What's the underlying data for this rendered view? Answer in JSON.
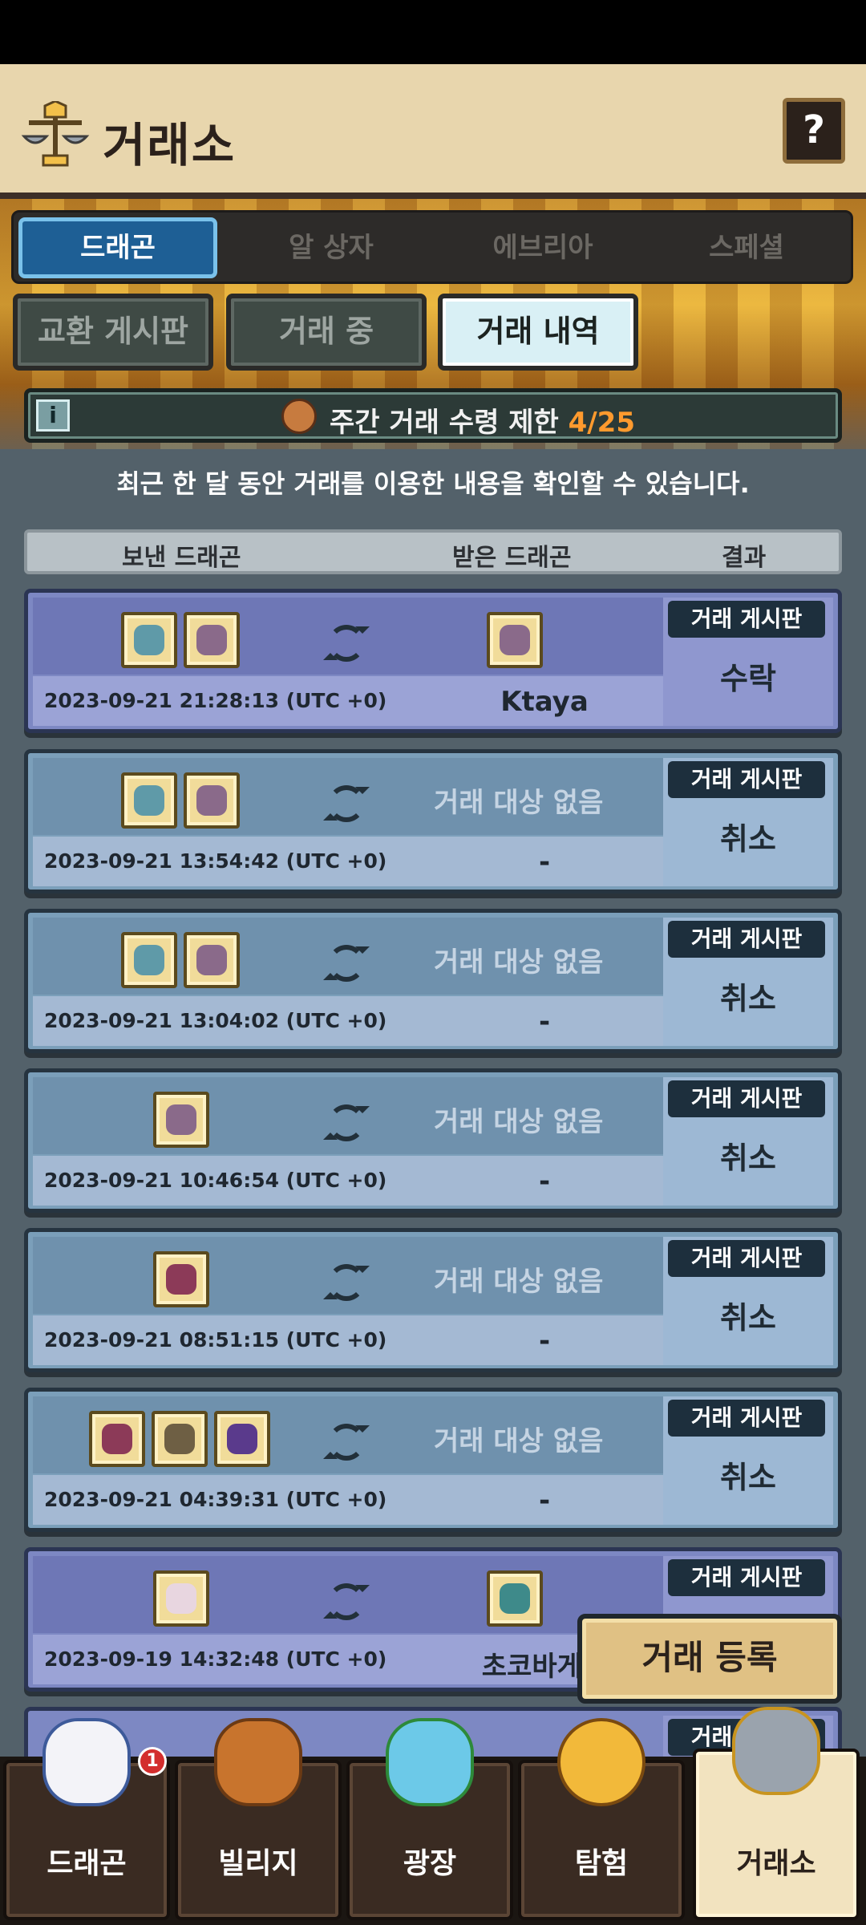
{
  "header": {
    "title": "거래소",
    "help_label": "?"
  },
  "species_tabs": [
    {
      "label": "드래곤",
      "active": true
    },
    {
      "label": "알 상자",
      "active": false
    },
    {
      "label": "에브리아",
      "active": false
    },
    {
      "label": "스페셜",
      "active": false
    }
  ],
  "sub_tabs": [
    {
      "label": "교환 게시판",
      "active": false
    },
    {
      "label": "거래 중",
      "active": false
    },
    {
      "label": "거래 내역",
      "active": true
    }
  ],
  "limit": {
    "label": "주간 거래 수령 제한",
    "count": "4/25"
  },
  "notice": "최근 한 달 동안 거래를 이용한 내용을 확인할 수 있습니다.",
  "table_header": {
    "sent": "보낸 드래곤",
    "received": "받은 드래곤",
    "result": "결과"
  },
  "rows": [
    {
      "date": "2023-09-21 21:28:13 (UTC +0)",
      "partner": "Ktaya",
      "board": "거래 게시판",
      "outcome": "수락",
      "received_text": ""
    },
    {
      "date": "2023-09-21 13:54:42 (UTC +0)",
      "partner": "-",
      "board": "거래 게시판",
      "outcome": "취소",
      "received_text": "거래 대상 없음"
    },
    {
      "date": "2023-09-21 13:04:02 (UTC +0)",
      "partner": "-",
      "board": "거래 게시판",
      "outcome": "취소",
      "received_text": "거래 대상 없음"
    },
    {
      "date": "2023-09-21 10:46:54 (UTC +0)",
      "partner": "-",
      "board": "거래 게시판",
      "outcome": "취소",
      "received_text": "거래 대상 없음"
    },
    {
      "date": "2023-09-21 08:51:15 (UTC +0)",
      "partner": "-",
      "board": "거래 게시판",
      "outcome": "취소",
      "received_text": "거래 대상 없음"
    },
    {
      "date": "2023-09-21 04:39:31 (UTC +0)",
      "partner": "-",
      "board": "거래 게시판",
      "outcome": "취소",
      "received_text": "거래 대상 없음"
    },
    {
      "date": "2023-09-19 14:32:48 (UTC +0)",
      "partner": "초코바게트",
      "board": "거래 게시판",
      "outcome": "",
      "received_text": ""
    }
  ],
  "peek_row": {
    "board": "거래 게시판"
  },
  "register_label": "거래 등록",
  "nav": [
    {
      "label": "드래곤",
      "badge": "1"
    },
    {
      "label": "빌리지"
    },
    {
      "label": "광장"
    },
    {
      "label": "탐험"
    },
    {
      "label": "거래소"
    }
  ],
  "colors": {
    "accent_orange": "#ff9a2e",
    "active_tab_blue": "#1e5f95",
    "accepted_row": "#7d88c3",
    "cancel_row": "#7b9fba"
  },
  "icons": [
    "scale-icon",
    "info-icon",
    "swap-icon",
    "dragon-icon"
  ]
}
